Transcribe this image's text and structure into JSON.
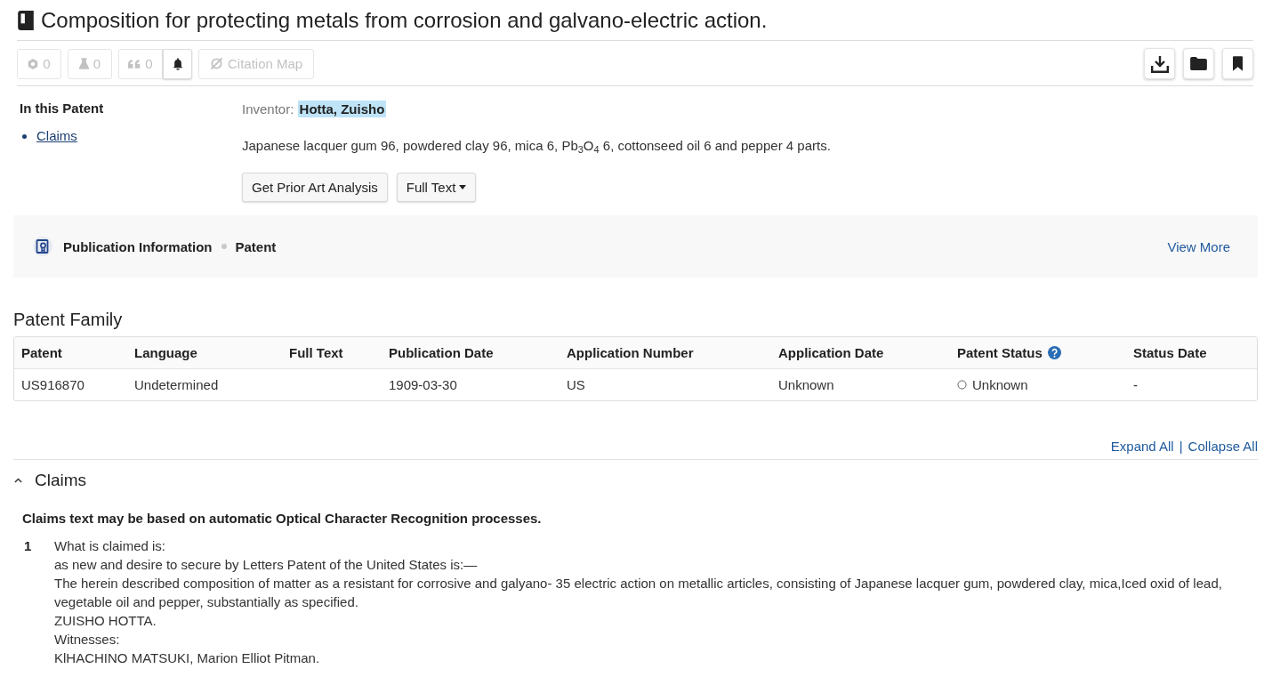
{
  "header": {
    "title": "Composition for protecting metals from corrosion and galvano-electric action."
  },
  "toolbar": {
    "buttons": [
      {
        "kind": "hexagon",
        "count": "0",
        "disabled": true
      },
      {
        "kind": "flask",
        "count": "0",
        "disabled": true
      },
      {
        "kind": "quote",
        "count": "0",
        "disabled": true
      },
      {
        "kind": "bell",
        "disabled": false
      },
      {
        "kind": "citation_map",
        "label": "Citation Map",
        "disabled": true
      }
    ],
    "actions": [
      {
        "kind": "download"
      },
      {
        "kind": "folder"
      },
      {
        "kind": "bookmark"
      }
    ]
  },
  "sidebar": {
    "title": "In this Patent",
    "items": [
      {
        "label": "Claims"
      }
    ]
  },
  "summary": {
    "inventor_label": "Inventor:",
    "inventor": "Hotta, Zuisho",
    "inventor_highlighted": true,
    "abstract": "Japanese lacquer gum 96, powdered clay 96, mica 6, Pb$_{3}$O$_{4}$ 6, cottonseed oil 6 and pepper 4 parts.",
    "buttons": [
      {
        "label": "Get Prior Art Analysis",
        "dropdown": false
      },
      {
        "label": "Full Text",
        "dropdown": true
      }
    ]
  },
  "publication_info": {
    "title": "Publication Information",
    "type": "Patent",
    "link": "View More"
  },
  "patent_family": {
    "title": "Patent Family",
    "columns": [
      {
        "label": "Patent",
        "help": false
      },
      {
        "label": "Language",
        "help": false
      },
      {
        "label": "Full Text",
        "help": false
      },
      {
        "label": "Publication Date",
        "help": false
      },
      {
        "label": "Application Number",
        "help": false
      },
      {
        "label": "Application Date",
        "help": false
      },
      {
        "label": "Patent Status",
        "help": true
      },
      {
        "label": "Status Date",
        "help": false
      }
    ],
    "rows": [
      {
        "patent": "US916870",
        "language": "Undetermined",
        "publication_date": "1909-03-30",
        "application_number": "US",
        "application_date": "Unknown",
        "status": {
          "kind": "unknown",
          "label": "Unknown"
        },
        "status_date": "-"
      }
    ]
  },
  "claims": {
    "links": [
      "Expand All",
      "Collapse All"
    ],
    "link_separator": "|",
    "title": "Claims",
    "expanded": true,
    "notice": "Claims text may be based on automatic Optical Character Recognition processes.",
    "items": [
      {
        "number": "1",
        "lines": [
          "What is claimed is:",
          "as new and desire to secure by Letters Patent of the United States is:—",
          "The herein described composition of matter as a resistant for corrosive and galyano- 35 electric action on metallic articles, consisting of Japanese lacquer gum, powdered clay, mica,Iced oxid of lead, vegetable oil and pepper, substantially as specified.",
          "ZUISHO HOTTA.",
          "Witnesses:",
          "KlHACHINO MATSUKI, Marion Elliot Pitman."
        ]
      }
    ]
  }
}
